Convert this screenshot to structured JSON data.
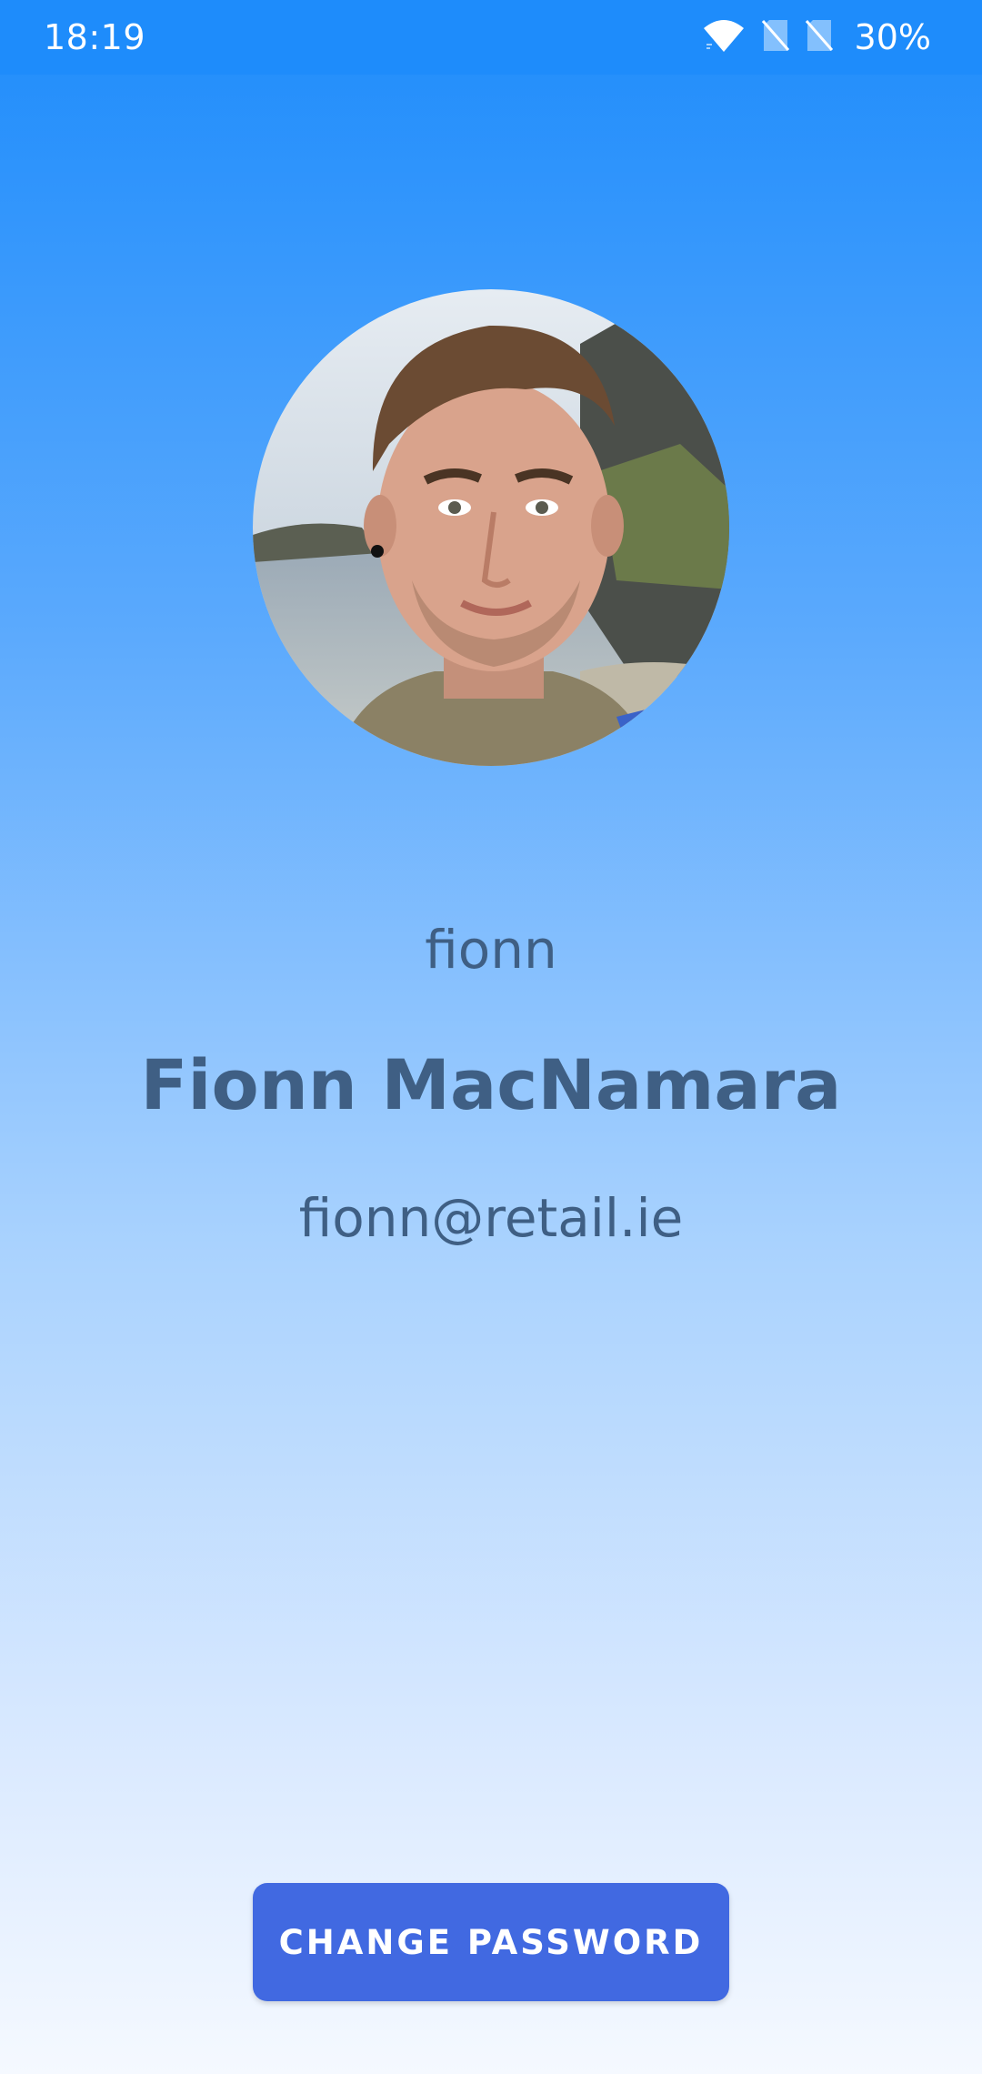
{
  "status_bar": {
    "time": "18:19",
    "battery": "30%",
    "icons": [
      "wifi-icon",
      "sim-off-icon",
      "sim-off-icon"
    ]
  },
  "profile": {
    "avatar": "profile-photo",
    "username": "fionn",
    "full_name": "Fionn MacNamara",
    "email": "fionn@retail.ie"
  },
  "actions": {
    "change_password_label": "CHANGE PASSWORD"
  },
  "colors": {
    "status_bar": "#1e8cfb",
    "text": "#3f5f84",
    "button": "#4169e1"
  }
}
